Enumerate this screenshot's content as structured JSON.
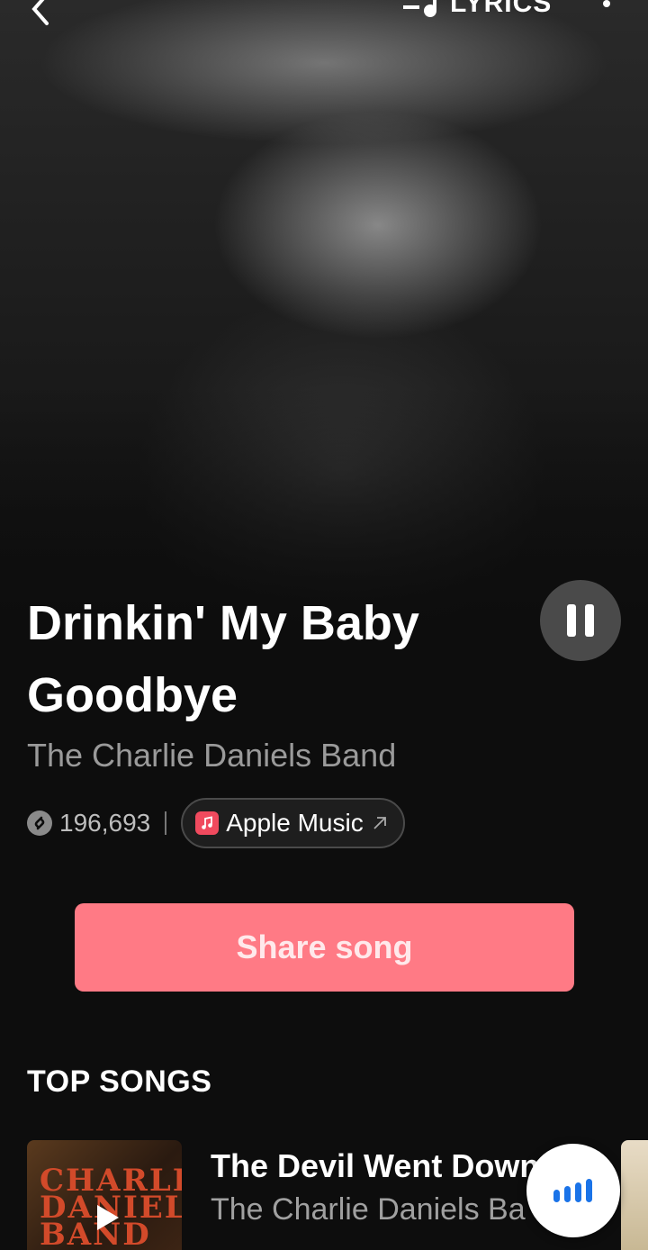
{
  "header": {
    "back_icon": "chevron-left-icon",
    "lyrics_icon": "lyrics-note-icon",
    "lyrics_label": "LYRICS",
    "more_icon": "more-vertical-icon"
  },
  "track": {
    "title": "Drinkin' My Baby Goodbye",
    "artist": "The Charlie Daniels Band",
    "shazam_count": "196,693",
    "apple_music_label": "Apple Music"
  },
  "player": {
    "state_icon": "pause-icon"
  },
  "actions": {
    "share_label": "Share song"
  },
  "top_songs": {
    "section_title": "TOP SONGS",
    "items": [
      {
        "title": "The Devil Went Down",
        "artist": "The Charlie Daniels Ba",
        "art_text": "The CHARLIE DANIELS BAND"
      }
    ]
  },
  "colors": {
    "accent": "#ff7a85",
    "apple_music": "#f04a5e",
    "floating_icon": "#1a73e8",
    "background": "#0d0d0d"
  }
}
